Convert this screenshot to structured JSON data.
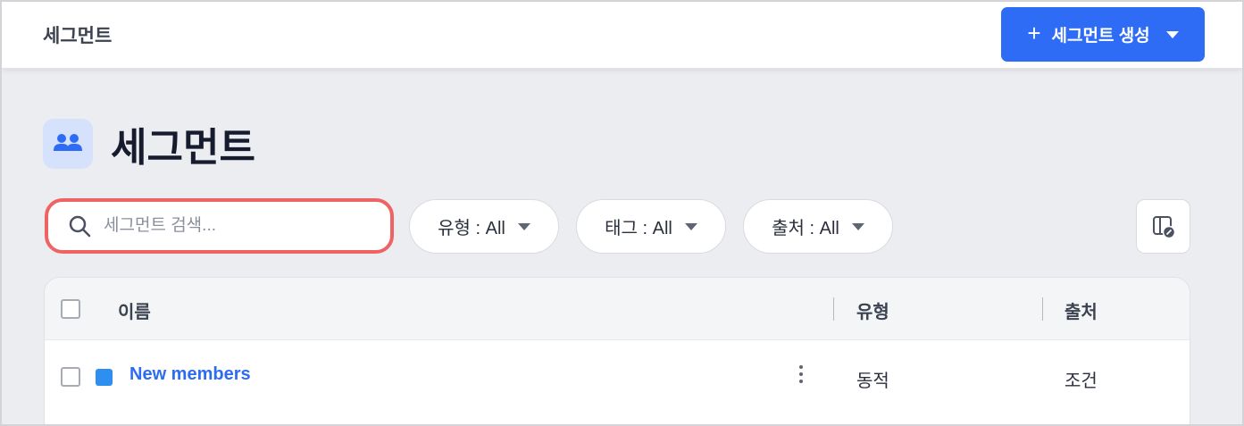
{
  "topbar": {
    "title": "세그먼트",
    "create_button": {
      "icon": "+",
      "label": "세그먼트 생성",
      "accent": "#2f6cf6"
    }
  },
  "page": {
    "icon": "people-icon",
    "title": "세그먼트"
  },
  "search": {
    "placeholder": "세그먼트 검색...",
    "value": ""
  },
  "filters": [
    {
      "label": "유형 : All"
    },
    {
      "label": "태그 : All"
    },
    {
      "label": "출처 : All"
    }
  ],
  "table": {
    "columns": {
      "name": "이름",
      "type": "유형",
      "source": "출처"
    },
    "rows": [
      {
        "name": "New members",
        "color": "#2e8ff0",
        "type": "동적",
        "source": "조건"
      }
    ]
  }
}
